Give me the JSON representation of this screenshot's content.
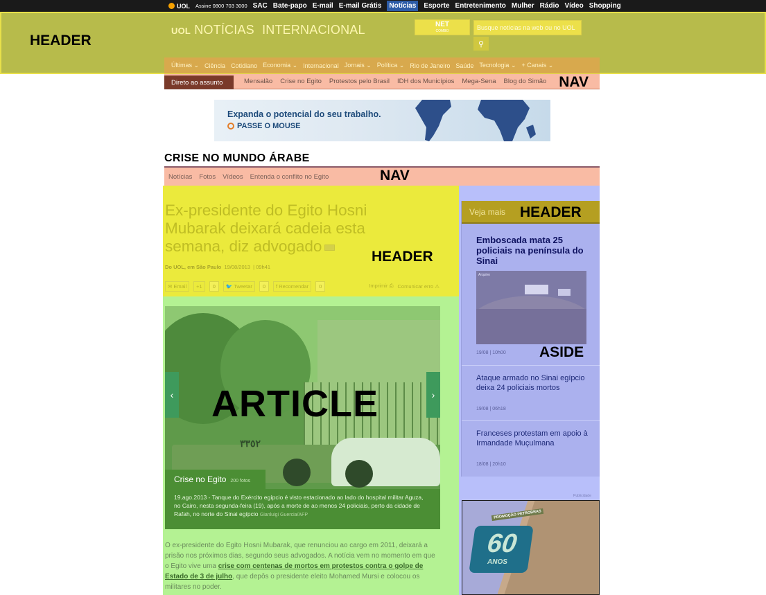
{
  "topbar": {
    "logo": "UOL",
    "assine": "Assine 0800 703 3000",
    "links": [
      "SAC",
      "Bate-papo",
      "E-mail",
      "E-mail Grátis",
      "Notícias",
      "Esporte",
      "Entretenimento",
      "Mulher",
      "Rádio",
      "Vídeo",
      "Shopping"
    ],
    "active": "Notícias"
  },
  "header": {
    "region_label": "HEADER",
    "brand_uol": "UOL",
    "brand_noticias": "NOTÍCIAS",
    "brand_section": "INTERNACIONAL",
    "net_logo": "NET",
    "net_sub": "COMBO",
    "search_placeholder": "Busque notícias na web ou no UOL",
    "search_icon": "search-icon"
  },
  "main_nav": {
    "items": [
      "Últimas ⌄",
      "Ciência",
      "Cotidiano",
      "Economia ⌄",
      "Internacional",
      "Jornais ⌄",
      "Política ⌄",
      "Rio de Janeiro",
      "Saúde",
      "Tecnologia ⌄",
      "+ Canais ⌄"
    ]
  },
  "sub_nav": {
    "direct_label": "Direto ao assunto",
    "items": [
      "Mensalão",
      "Crise no Egito",
      "Protestos pelo Brasil",
      "IDH dos Municípios",
      "Mega-Sena",
      "Blog do Simão"
    ],
    "region_label": "NAV"
  },
  "banner": {
    "line1": "Expanda o potencial do seu trabalho.",
    "line2": "PASSE O MOUSE"
  },
  "section": {
    "title": "CRISE NO MUNDO ÁRABE",
    "nav_items": [
      "Notícias",
      "Fotos",
      "Vídeos",
      "Entenda o conflito no Egito"
    ],
    "nav_region_label": "NAV"
  },
  "article": {
    "region_label": "ARTICLE",
    "header_region_label": "HEADER",
    "headline": "Ex-presidente do Egito Hosni Mubarak deixará cadeia esta semana, diz advogado",
    "byline_source": "Do UOL, em São Paulo",
    "byline_date": "19/08/2013",
    "byline_time": "09h41",
    "share": {
      "email": "Email",
      "gplus": "+1",
      "gplus_count": "0",
      "tweet": "Tweetar",
      "tweet_count": "0",
      "facebook": "Recomendar",
      "facebook_count": "0",
      "print": "Imprimir",
      "report": "Comunicar erro"
    },
    "gallery": {
      "arabic_text": "٣٣٥٢",
      "title": "Crise no Egito",
      "count": "200 fotos",
      "caption": "19.ago.2013 - Tanque do Exército egípcio é visto estacionado ao lado do hospital militar Aguza, no Cairo, nesta segunda-feira (19), após a morte de ao menos 24 policiais, perto da cidade de Rafah, no norte do Sinai egípcio",
      "credit": "Gianluigi Guercia/AFP",
      "prev_icon": "chevron-left-icon",
      "next_icon": "chevron-right-icon"
    },
    "body_before": "O ex-presidente do Egito Hosni Mubarak, que renunciou ao cargo em 2011, deixará a prisão nos próximos dias, segundo seus advogados. A notícia vem no momento em que o Egito vive uma ",
    "body_link": "crise com centenas de mortos em protestos contra o golpe de Estado de 3 de julho",
    "body_after": ", que depôs o presidente eleito Mohamed Mursi e colocou os militares no poder."
  },
  "aside": {
    "region_label": "ASIDE",
    "header_label": "Veja mais",
    "header_region_label": "HEADER",
    "photo_tag": "Arquivo",
    "items": [
      {
        "title": "Emboscada mata 25 policiais na península do Sinai",
        "date": "19/08",
        "time": "10h00"
      },
      {
        "title": "Ataque armado no Sinai egípcio deixa 24 policiais mortos",
        "date": "19/08",
        "time": "06h18"
      },
      {
        "title": "Franceses protestam em apoio à Irmandade Muçulmana",
        "date": "18/08",
        "time": "20h10"
      }
    ],
    "ad_label": "Publicidade",
    "ad_promo": "PROMOÇÃO PETROBRAS",
    "ad_number": "60",
    "ad_anos": "ANOS"
  }
}
